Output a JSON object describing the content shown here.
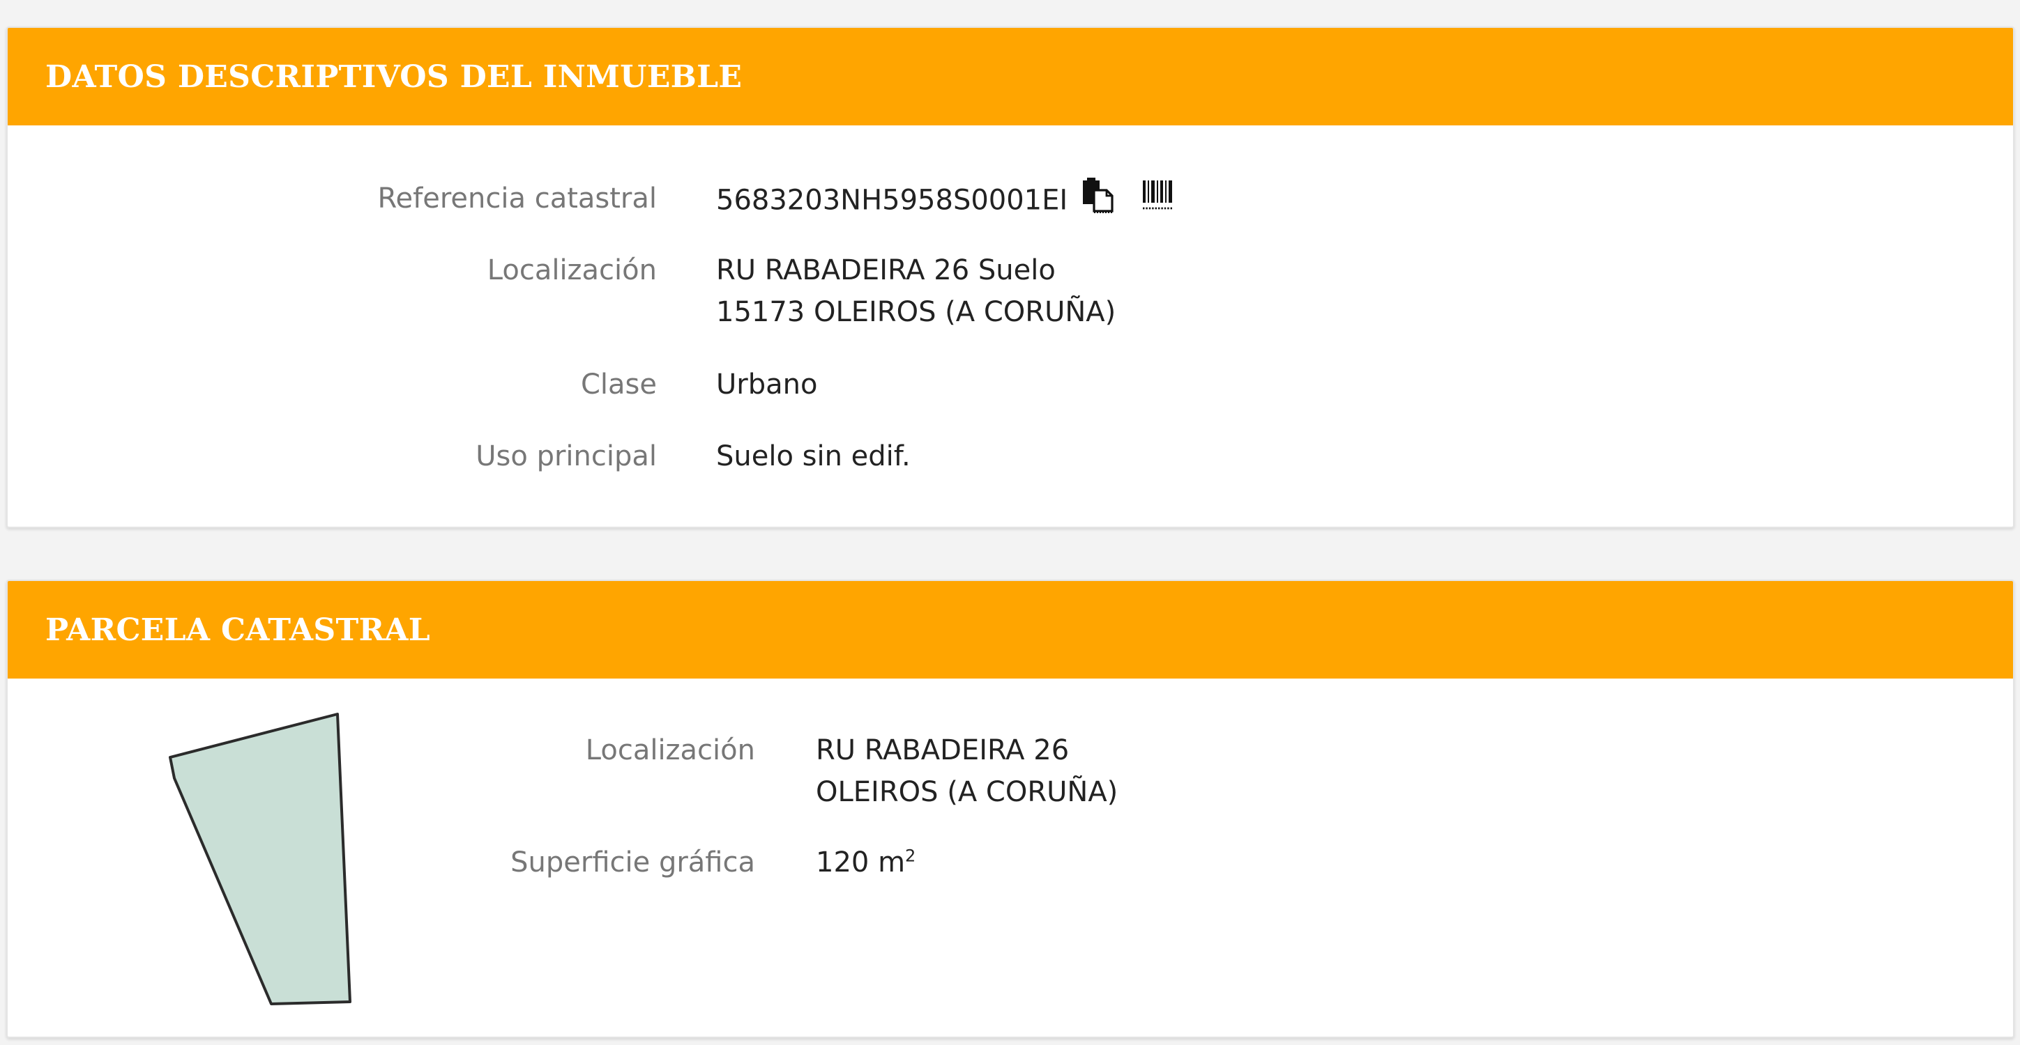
{
  "section1": {
    "title": "DATOS DESCRIPTIVOS DEL INMUEBLE",
    "referencia_label": "Referencia catastral",
    "referencia_value": "5683203NH5958S0001EI",
    "localizacion_label": "Localización",
    "localizacion_line1": "RU RABADEIRA 26 Suelo",
    "localizacion_line2": "15173 OLEIROS (A CORUÑA)",
    "clase_label": "Clase",
    "clase_value": "Urbano",
    "uso_label": "Uso principal",
    "uso_value": "Suelo sin edif.",
    "icons": [
      "copy-icon",
      "barcode-icon"
    ]
  },
  "section2": {
    "title": "PARCELA CATASTRAL",
    "localizacion_label": "Localización",
    "localizacion_line1": "RU RABADEIRA 26",
    "localizacion_line2": "OLEIROS (A CORUÑA)",
    "superficie_label": "Superficie gráfica",
    "superficie_value": "120 m",
    "superficie_unit_exp": "2"
  },
  "colors": {
    "header_bg": "#ffa500",
    "parcel_fill": "#c9dfd6"
  }
}
